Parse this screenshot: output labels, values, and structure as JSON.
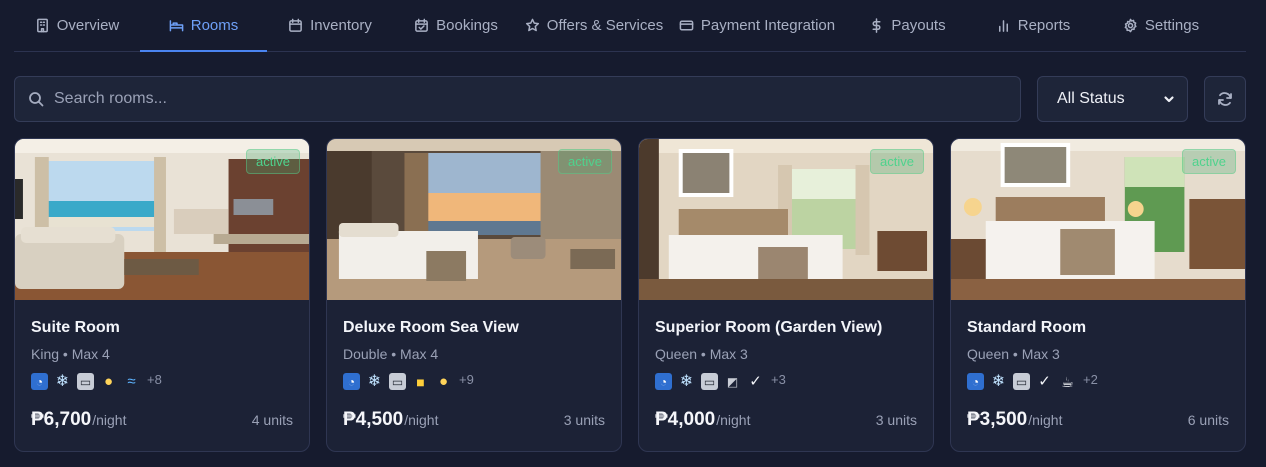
{
  "tabs": [
    {
      "label": "Overview",
      "icon": "building-icon",
      "active": false
    },
    {
      "label": "Rooms",
      "icon": "bed-icon",
      "active": true
    },
    {
      "label": "Inventory",
      "icon": "calendar-icon",
      "active": false
    },
    {
      "label": "Bookings",
      "icon": "calendar-check-icon",
      "active": false
    },
    {
      "label": "Offers & Services",
      "icon": "star-icon",
      "active": false
    },
    {
      "label": "Payment Integration",
      "icon": "credit-card-icon",
      "active": false
    },
    {
      "label": "Payouts",
      "icon": "dollar-icon",
      "active": false
    },
    {
      "label": "Reports",
      "icon": "bar-chart-icon",
      "active": false
    },
    {
      "label": "Settings",
      "icon": "gear-icon",
      "active": false
    }
  ],
  "search": {
    "placeholder": "Search rooms..."
  },
  "status_filter": {
    "selected": "All Status"
  },
  "colors": {
    "accent": "#4a84f0",
    "active_badge": "#4fd28d",
    "background": "#161b2e",
    "card": "#1c2236"
  },
  "rooms": [
    {
      "name": "Suite Room",
      "details": "King • Max 4",
      "status": "active",
      "amenities": [
        "wifi-icon",
        "snowflake-icon",
        "tv-icon",
        "pool-icon",
        "wave-icon"
      ],
      "more": "+8",
      "price": "₱6,700",
      "per": "/night",
      "units": "4 units"
    },
    {
      "name": "Deluxe Room Sea View",
      "details": "Double • Max 4",
      "status": "active",
      "amenities": [
        "wifi-icon",
        "snowflake-icon",
        "tv-icon",
        "lock-icon",
        "pool-icon"
      ],
      "more": "+9",
      "price": "₱4,500",
      "per": "/night",
      "units": "3 units"
    },
    {
      "name": "Superior Room (Garden View)",
      "details": "Queen • Max 3",
      "status": "active",
      "amenities": [
        "wifi-icon",
        "snowflake-icon",
        "tv-icon",
        "kitchen-icon",
        "check-icon"
      ],
      "more": "+3",
      "price": "₱4,000",
      "per": "/night",
      "units": "3 units"
    },
    {
      "name": "Standard Room",
      "details": "Queen • Max 3",
      "status": "active",
      "amenities": [
        "wifi-icon",
        "snowflake-icon",
        "tv-icon",
        "check-icon",
        "coffee-icon"
      ],
      "more": "+2",
      "price": "₱3,500",
      "per": "/night",
      "units": "6 units"
    }
  ]
}
